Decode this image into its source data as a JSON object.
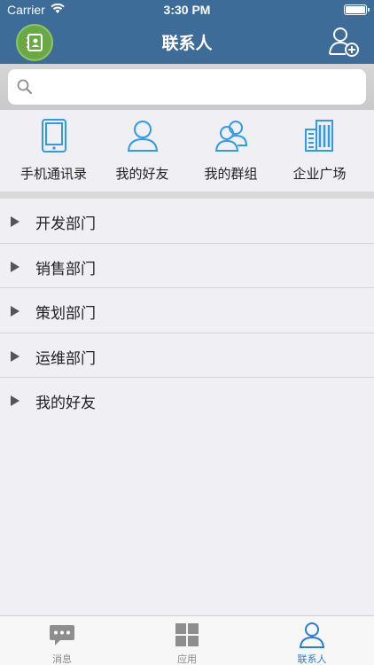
{
  "status_bar": {
    "carrier": "Carrier",
    "time": "3:30 PM"
  },
  "nav": {
    "title": "联系人",
    "left_icon": "address-book-icon",
    "right_icon": "add-contact-icon"
  },
  "search": {
    "placeholder": "",
    "value": ""
  },
  "quick_actions": [
    {
      "label": "手机通讯录",
      "icon": "phone-icon"
    },
    {
      "label": "我的好友",
      "icon": "user-icon"
    },
    {
      "label": "我的群组",
      "icon": "group-icon"
    },
    {
      "label": "企业广场",
      "icon": "building-icon"
    }
  ],
  "groups": [
    {
      "label": "开发部门"
    },
    {
      "label": "销售部门"
    },
    {
      "label": "策划部门"
    },
    {
      "label": "运维部门"
    },
    {
      "label": "我的好友"
    }
  ],
  "tabbar": {
    "tabs": [
      {
        "label": "消息",
        "icon": "chat-icon",
        "active": false
      },
      {
        "label": "应用",
        "icon": "grid-icon",
        "active": false
      },
      {
        "label": "联系人",
        "icon": "contacts-icon",
        "active": true
      }
    ]
  },
  "colors": {
    "header": "#3d6c99",
    "accent": "#2a7bd6",
    "icon_blue": "#2f9be8",
    "avatar_green": "#6aa843"
  }
}
